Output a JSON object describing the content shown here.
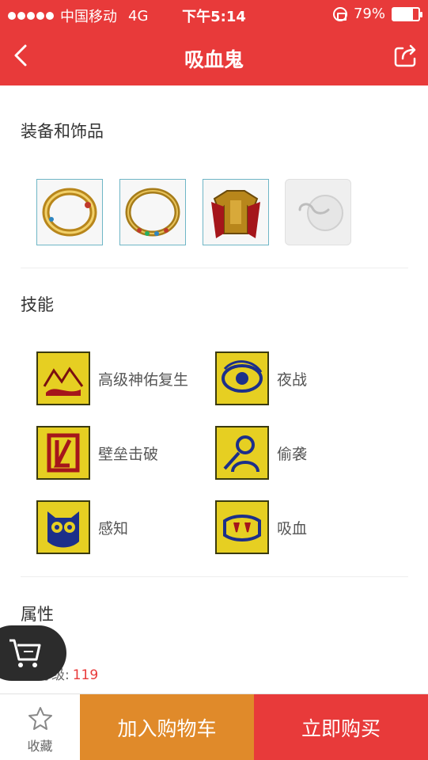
{
  "status": {
    "carrier": "中国移动",
    "network": "4G",
    "time": "下午5:14",
    "battery": "79%",
    "battery_level": 0.79
  },
  "nav": {
    "title": "吸血鬼",
    "back_icon": "chevron-left-icon",
    "share_icon": "share-icon"
  },
  "equipment": {
    "title": "装备和饰品",
    "items": [
      "gold-ring-icon",
      "jeweled-ring-icon",
      "red-armor-icon",
      "empty-slot-icon"
    ]
  },
  "skills": {
    "title": "技能",
    "items": [
      {
        "label": "高级神佑复生",
        "icon": "resurrection-icon"
      },
      {
        "label": "夜战",
        "icon": "eye-icon"
      },
      {
        "label": "壁垒击破",
        "icon": "rampart-break-icon"
      },
      {
        "label": "偷袭",
        "icon": "ambush-icon"
      },
      {
        "label": "感知",
        "icon": "owl-icon"
      },
      {
        "label": "吸血",
        "icon": "fangs-icon"
      }
    ]
  },
  "attributes": {
    "title": "属性",
    "level_label": "等级:",
    "level_value": "119"
  },
  "bottom": {
    "fav_label": "收藏",
    "cart_label": "加入购物车",
    "buy_label": "立即购买"
  },
  "colors": {
    "brand_red": "#e83a3a",
    "cart_orange": "#e08a2a"
  }
}
